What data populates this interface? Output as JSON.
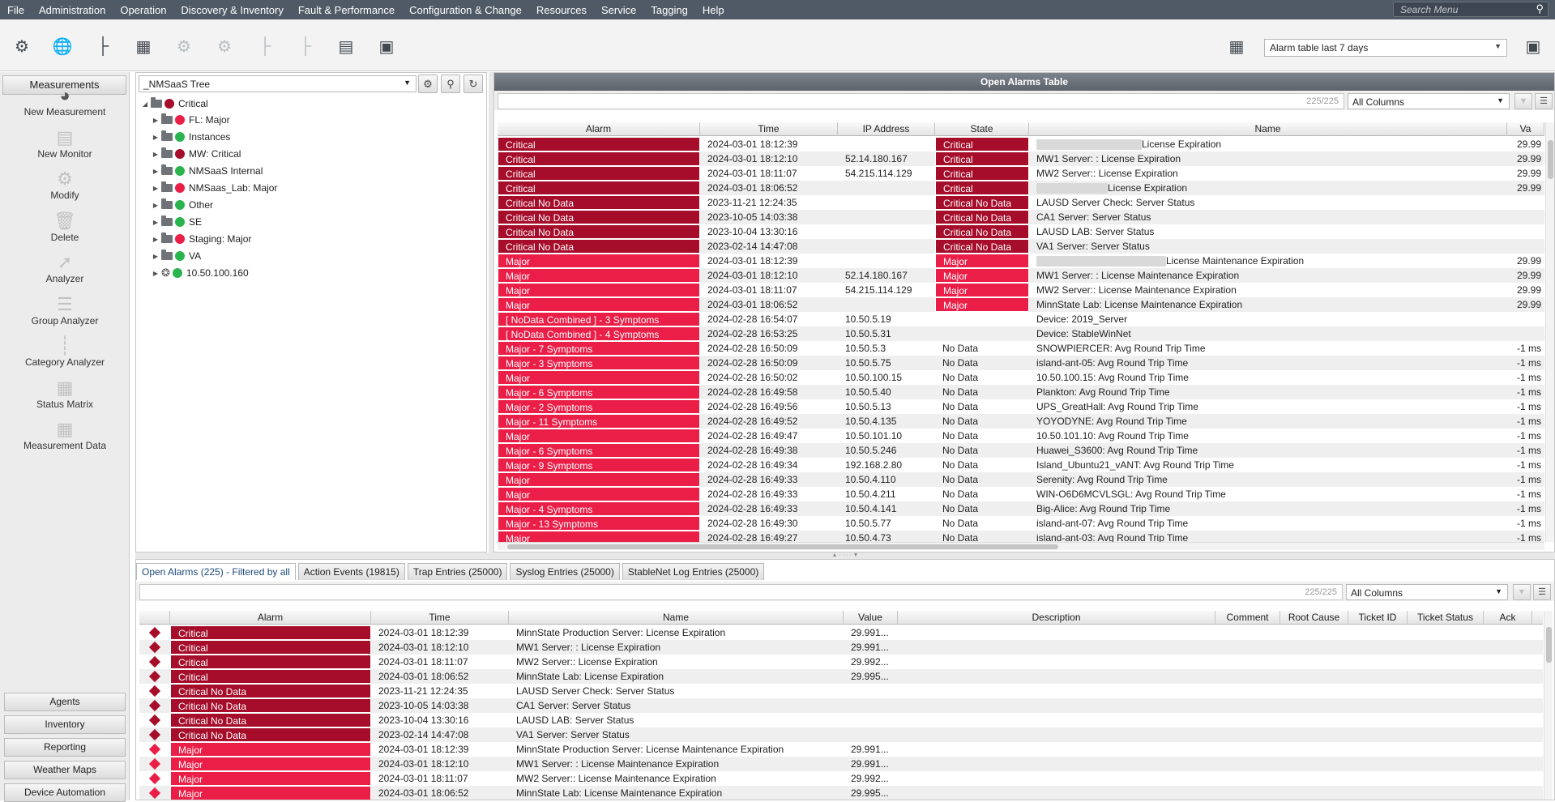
{
  "menubar": {
    "items": [
      "File",
      "Administration",
      "Operation",
      "Discovery & Inventory",
      "Fault & Performance",
      "Configuration & Change",
      "Resources",
      "Service",
      "Tagging",
      "Help"
    ],
    "search_placeholder": "Search Menu"
  },
  "toolbar": {
    "icons": [
      "gear-icon",
      "globe-icon",
      "tree-icon",
      "table-icon",
      "gear-add-icon",
      "gear-edit-icon",
      "node-add-icon",
      "node-remove-icon",
      "table-clock-icon",
      "table-export-icon"
    ],
    "view_select": "Alarm table last 7 days"
  },
  "left_panel": {
    "header": "Measurements",
    "items": [
      {
        "label": "New Measurement",
        "icon": "new-measurement-icon"
      },
      {
        "label": "New Monitor",
        "icon": "monitor-icon"
      },
      {
        "label": "Modify",
        "icon": "gear-icon"
      },
      {
        "label": "Delete",
        "icon": "trash-icon"
      },
      {
        "label": "Analyzer",
        "icon": "line-chart-icon"
      },
      {
        "label": "Group Analyzer",
        "icon": "group-chart-icon"
      },
      {
        "label": "Category Analyzer",
        "icon": "category-chart-icon"
      },
      {
        "label": "Status Matrix",
        "icon": "matrix-icon"
      },
      {
        "label": "Measurement Data",
        "icon": "data-table-icon"
      }
    ],
    "bottom_buttons": [
      "Agents",
      "Inventory",
      "Reporting",
      "Weather Maps",
      "Device Automation"
    ]
  },
  "tree": {
    "selector": "_NMSaaS Tree",
    "root": {
      "label": "Critical",
      "status": "crit"
    },
    "children": [
      {
        "label": "FL: Major",
        "status": "major"
      },
      {
        "label": "Instances",
        "status": "ok"
      },
      {
        "label": "MW: Critical",
        "status": "crit"
      },
      {
        "label": "NMSaaS Internal",
        "status": "ok"
      },
      {
        "label": "NMSaas_Lab: Major",
        "status": "major"
      },
      {
        "label": "Other",
        "status": "ok"
      },
      {
        "label": "SE",
        "status": "ok"
      },
      {
        "label": "Staging: Major",
        "status": "major"
      },
      {
        "label": "VA",
        "status": "ok"
      },
      {
        "label": "10.50.100.160",
        "status": "ok",
        "type": "device"
      }
    ]
  },
  "open_alarms_table": {
    "title": "Open Alarms Table",
    "count": "225/225",
    "column_filter": "All Columns",
    "columns": [
      "Alarm",
      "Time",
      "IP Address",
      "State",
      "Name",
      "Va"
    ],
    "rows": [
      {
        "alarm": "Critical",
        "sev": "crit",
        "time": "2024-03-01 18:12:39",
        "ip": "",
        "state": "Critical",
        "state_sev": "crit",
        "name": "License Expiration",
        "redact": 130,
        "value": "29.99"
      },
      {
        "alarm": "Critical",
        "sev": "crit",
        "time": "2024-03-01 18:12:10",
        "ip": "52.14.180.167",
        "state": "Critical",
        "state_sev": "crit",
        "name": "MW1 Server: : License Expiration",
        "redact": 0,
        "value": "29.99"
      },
      {
        "alarm": "Critical",
        "sev": "crit",
        "time": "2024-03-01 18:11:07",
        "ip": "54.215.114.129",
        "state": "Critical",
        "state_sev": "crit",
        "name": "MW2 Server:: License Expiration",
        "redact": 0,
        "value": "29.99"
      },
      {
        "alarm": "Critical",
        "sev": "crit",
        "time": "2024-03-01 18:06:52",
        "ip": "",
        "state": "Critical",
        "state_sev": "crit",
        "name": "License Expiration",
        "redact": 88,
        "value": "29.99"
      },
      {
        "alarm": "Critical No Data",
        "sev": "crit",
        "time": "2023-11-21 12:24:35",
        "ip": "",
        "state": "Critical No Data",
        "state_sev": "crit",
        "name": "LAUSD Server Check: Server Status",
        "redact": 0,
        "value": ""
      },
      {
        "alarm": "Critical No Data",
        "sev": "crit",
        "time": "2023-10-05 14:03:38",
        "ip": "",
        "state": "Critical No Data",
        "state_sev": "crit",
        "name": "CA1 Server: Server Status",
        "redact": 0,
        "value": ""
      },
      {
        "alarm": "Critical No Data",
        "sev": "crit",
        "time": "2023-10-04 13:30:16",
        "ip": "",
        "state": "Critical No Data",
        "state_sev": "crit",
        "name": "LAUSD LAB: Server Status",
        "redact": 0,
        "value": ""
      },
      {
        "alarm": "Critical No Data",
        "sev": "crit",
        "time": "2023-02-14 14:47:08",
        "ip": "",
        "state": "Critical No Data",
        "state_sev": "crit",
        "name": "VA1 Server: Server Status",
        "redact": 0,
        "value": ""
      },
      {
        "alarm": "Major",
        "sev": "major",
        "time": "2024-03-01 18:12:39",
        "ip": "",
        "state": "Major",
        "state_sev": "major",
        "name": "License Maintenance Expiration",
        "redact": 160,
        "value": "29.99"
      },
      {
        "alarm": "Major",
        "sev": "major",
        "time": "2024-03-01 18:12:10",
        "ip": "52.14.180.167",
        "state": "Major",
        "state_sev": "major",
        "name": "MW1 Server: : License Maintenance Expiration",
        "redact": 0,
        "value": "29.99"
      },
      {
        "alarm": "Major",
        "sev": "major",
        "time": "2024-03-01 18:11:07",
        "ip": "54.215.114.129",
        "state": "Major",
        "state_sev": "major",
        "name": "MW2 Server:: License Maintenance Expiration",
        "redact": 0,
        "value": "29.99"
      },
      {
        "alarm": "Major",
        "sev": "major",
        "time": "2024-03-01 18:06:52",
        "ip": "",
        "state": "Major",
        "state_sev": "major",
        "name": "MinnState Lab: License Maintenance Expiration",
        "redact": 0,
        "value": "29.99"
      },
      {
        "alarm": "[ NoData Combined ] - 3 Symptoms",
        "sev": "major",
        "time": "2024-02-28 16:54:07",
        "ip": "10.50.5.19",
        "state": "",
        "state_sev": "",
        "name": "Device: 2019_Server",
        "redact": 0,
        "value": ""
      },
      {
        "alarm": "[ NoData Combined ] - 4 Symptoms",
        "sev": "major",
        "time": "2024-02-28 16:53:25",
        "ip": "10.50.5.31",
        "state": "",
        "state_sev": "",
        "name": "Device: StableWinNet",
        "redact": 0,
        "value": ""
      },
      {
        "alarm": "Major - 7 Symptoms",
        "sev": "major",
        "time": "2024-02-28 16:50:09",
        "ip": "10.50.5.3",
        "state": "No Data",
        "state_sev": "",
        "name": "SNOWPIERCER: Avg Round Trip Time",
        "redact": 0,
        "value": "-1 ms"
      },
      {
        "alarm": "Major - 3 Symptoms",
        "sev": "major",
        "time": "2024-02-28 16:50:09",
        "ip": "10.50.5.75",
        "state": "No Data",
        "state_sev": "",
        "name": "island-ant-05: Avg Round Trip Time",
        "redact": 0,
        "value": "-1 ms"
      },
      {
        "alarm": "Major",
        "sev": "major",
        "time": "2024-02-28 16:50:02",
        "ip": "10.50.100.15",
        "state": "No Data",
        "state_sev": "",
        "name": "10.50.100.15: Avg Round Trip Time",
        "redact": 0,
        "value": "-1 ms"
      },
      {
        "alarm": "Major - 6 Symptoms",
        "sev": "major",
        "time": "2024-02-28 16:49:58",
        "ip": "10.50.5.40",
        "state": "No Data",
        "state_sev": "",
        "name": "Plankton: Avg Round Trip Time",
        "redact": 0,
        "value": "-1 ms"
      },
      {
        "alarm": "Major - 2 Symptoms",
        "sev": "major",
        "time": "2024-02-28 16:49:56",
        "ip": "10.50.5.13",
        "state": "No Data",
        "state_sev": "",
        "name": "UPS_GreatHall: Avg Round Trip Time",
        "redact": 0,
        "value": "-1 ms"
      },
      {
        "alarm": "Major - 11 Symptoms",
        "sev": "major",
        "time": "2024-02-28 16:49:52",
        "ip": "10.50.4.135",
        "state": "No Data",
        "state_sev": "",
        "name": "YOYODYNE: Avg Round Trip Time",
        "redact": 0,
        "value": "-1 ms"
      },
      {
        "alarm": "Major",
        "sev": "major",
        "time": "2024-02-28 16:49:47",
        "ip": "10.50.101.10",
        "state": "No Data",
        "state_sev": "",
        "name": "10.50.101.10: Avg Round Trip Time",
        "redact": 0,
        "value": "-1 ms"
      },
      {
        "alarm": "Major - 6 Symptoms",
        "sev": "major",
        "time": "2024-02-28 16:49:38",
        "ip": "10.50.5.246",
        "state": "No Data",
        "state_sev": "",
        "name": "Huawei_S3600: Avg Round Trip Time",
        "redact": 0,
        "value": "-1 ms"
      },
      {
        "alarm": "Major - 9 Symptoms",
        "sev": "major",
        "time": "2024-02-28 16:49:34",
        "ip": "192.168.2.80",
        "state": "No Data",
        "state_sev": "",
        "name": "Island_Ubuntu21_vANT: Avg Round Trip Time",
        "redact": 0,
        "value": "-1 ms"
      },
      {
        "alarm": "Major",
        "sev": "major",
        "time": "2024-02-28 16:49:33",
        "ip": "10.50.4.110",
        "state": "No Data",
        "state_sev": "",
        "name": "Serenity: Avg Round Trip Time",
        "redact": 0,
        "value": "-1 ms"
      },
      {
        "alarm": "Major",
        "sev": "major",
        "time": "2024-02-28 16:49:33",
        "ip": "10.50.4.211",
        "state": "No Data",
        "state_sev": "",
        "name": "WIN-O6D6MCVLSGL: Avg Round Trip Time",
        "redact": 0,
        "value": "-1 ms"
      },
      {
        "alarm": "Major - 4 Symptoms",
        "sev": "major",
        "time": "2024-02-28 16:49:33",
        "ip": "10.50.4.141",
        "state": "No Data",
        "state_sev": "",
        "name": "Big-Alice: Avg Round Trip Time",
        "redact": 0,
        "value": "-1 ms"
      },
      {
        "alarm": "Major - 13 Symptoms",
        "sev": "major",
        "time": "2024-02-28 16:49:30",
        "ip": "10.50.5.77",
        "state": "No Data",
        "state_sev": "",
        "name": "island-ant-07: Avg Round Trip Time",
        "redact": 0,
        "value": "-1 ms"
      },
      {
        "alarm": "Major",
        "sev": "major",
        "time": "2024-02-28 16:49:27",
        "ip": "10.50.4.73",
        "state": "No Data",
        "state_sev": "",
        "name": "island-ant-03: Avg Round Trip Time",
        "redact": 0,
        "value": "-1 ms"
      }
    ]
  },
  "bottom_tabs": [
    "Open Alarms (225) - Filtered by all",
    "Action Events (19815)",
    "Trap Entries (25000)",
    "Syslog Entries (25000)",
    "StableNet Log Entries (25000)"
  ],
  "bottom_table": {
    "count": "225/225",
    "column_filter": "All Columns",
    "columns": [
      "Alarm",
      "Time",
      "Name",
      "Value",
      "Description",
      "Comment",
      "Root Cause",
      "Ticket ID",
      "Ticket Status",
      "Ack"
    ],
    "rows": [
      {
        "alarm": "Critical",
        "sev": "crit",
        "time": "2024-03-01 18:12:39",
        "name": "MinnState Production Server: License Expiration",
        "value": "29.991..."
      },
      {
        "alarm": "Critical",
        "sev": "crit",
        "time": "2024-03-01 18:12:10",
        "name": "MW1 Server: : License Expiration",
        "value": "29.991..."
      },
      {
        "alarm": "Critical",
        "sev": "crit",
        "time": "2024-03-01 18:11:07",
        "name": "MW2 Server:: License Expiration",
        "value": "29.992..."
      },
      {
        "alarm": "Critical",
        "sev": "crit",
        "time": "2024-03-01 18:06:52",
        "name": "MinnState Lab: License Expiration",
        "value": "29.995..."
      },
      {
        "alarm": "Critical No Data",
        "sev": "crit",
        "time": "2023-11-21 12:24:35",
        "name": "LAUSD Server Check: Server Status",
        "value": ""
      },
      {
        "alarm": "Critical No Data",
        "sev": "crit",
        "time": "2023-10-05 14:03:38",
        "name": "CA1 Server: Server Status",
        "value": ""
      },
      {
        "alarm": "Critical No Data",
        "sev": "crit",
        "time": "2023-10-04 13:30:16",
        "name": "LAUSD LAB: Server Status",
        "value": ""
      },
      {
        "alarm": "Critical No Data",
        "sev": "crit",
        "time": "2023-02-14 14:47:08",
        "name": "VA1 Server: Server Status",
        "value": ""
      },
      {
        "alarm": "Major",
        "sev": "major",
        "time": "2024-03-01 18:12:39",
        "name": "MinnState Production Server: License Maintenance Expiration",
        "value": "29.991..."
      },
      {
        "alarm": "Major",
        "sev": "major",
        "time": "2024-03-01 18:12:10",
        "name": "MW1 Server: : License Maintenance Expiration",
        "value": "29.991..."
      },
      {
        "alarm": "Major",
        "sev": "major",
        "time": "2024-03-01 18:11:07",
        "name": "MW2 Server:: License Maintenance Expiration",
        "value": "29.992..."
      },
      {
        "alarm": "Major",
        "sev": "major",
        "time": "2024-03-01 18:06:52",
        "name": "MinnState Lab: License Maintenance Expiration",
        "value": "29.995..."
      }
    ]
  },
  "colors": {
    "critical": "#a50d2a",
    "major": "#ea1e47",
    "ok": "#2ab450",
    "header": "#505a66"
  }
}
